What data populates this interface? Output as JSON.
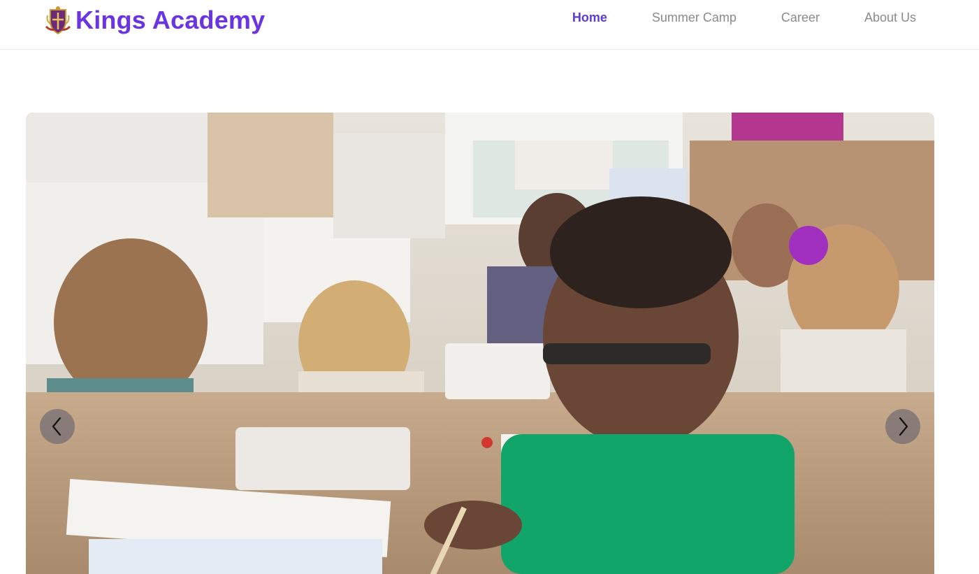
{
  "brand": {
    "name": "Kings Academy",
    "color": "#6a35e0"
  },
  "nav": {
    "items": [
      {
        "label": "Home",
        "active": true
      },
      {
        "label": "Summer Camp",
        "active": false
      },
      {
        "label": "Career",
        "active": false
      },
      {
        "label": "About Us",
        "active": false
      }
    ],
    "active_color": "#5a3bd6",
    "inactive_color": "#8a8a8a"
  },
  "carousel": {
    "slide_description_icon": "classroom-photo",
    "prev_icon": "chevron-left-icon",
    "next_icon": "chevron-right-icon"
  }
}
